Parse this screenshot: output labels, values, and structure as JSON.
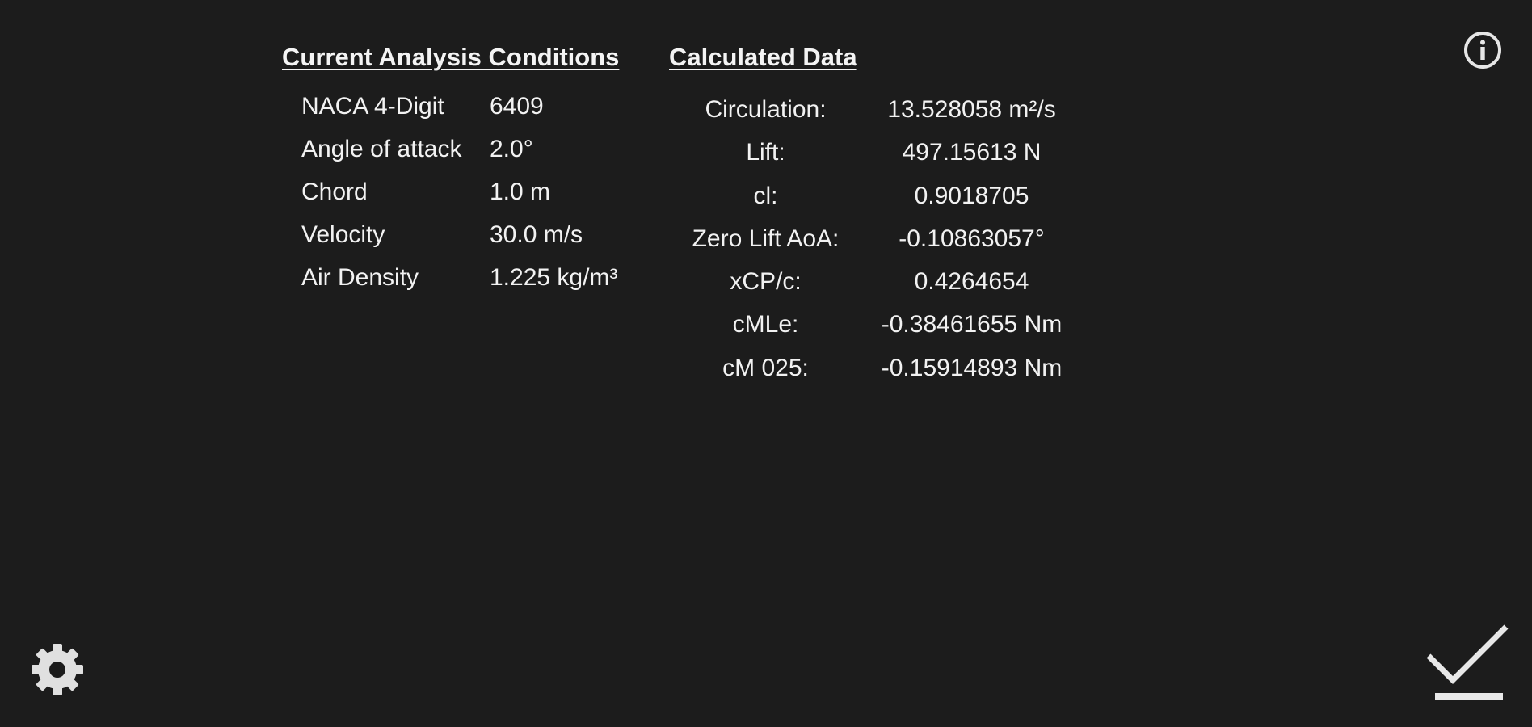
{
  "conditions": {
    "title": "Current Analysis Conditions",
    "rows": [
      {
        "label": "NACA 4-Digit",
        "value": "6409"
      },
      {
        "label": "Angle of attack",
        "value": "2.0°"
      },
      {
        "label": "Chord",
        "value": "1.0 m"
      },
      {
        "label": "Velocity",
        "value": "30.0 m/s"
      },
      {
        "label": "Air Density",
        "value": "1.225 kg/m³"
      }
    ]
  },
  "calculated": {
    "title": "Calculated Data",
    "rows": [
      {
        "label": "Circulation:",
        "value": "13.528058 m²/s"
      },
      {
        "label": "Lift:",
        "value": "497.15613 N"
      },
      {
        "label": "cl:",
        "value": "0.9018705"
      },
      {
        "label": "Zero Lift AoA:",
        "value": "-0.10863057°"
      },
      {
        "label": "xCP/c:",
        "value": "0.4264654"
      },
      {
        "label": "cMLe:",
        "value": "-0.38461655 Nm"
      },
      {
        "label": "cM 025:",
        "value": "-0.15914893 Nm"
      }
    ]
  },
  "icons": {
    "info": "info-icon",
    "settings": "gear-icon",
    "confirm": "check-icon"
  },
  "colors": {
    "background": "#1c1c1c",
    "text": "#f2f2f2",
    "icon": "#e6e6e6"
  }
}
